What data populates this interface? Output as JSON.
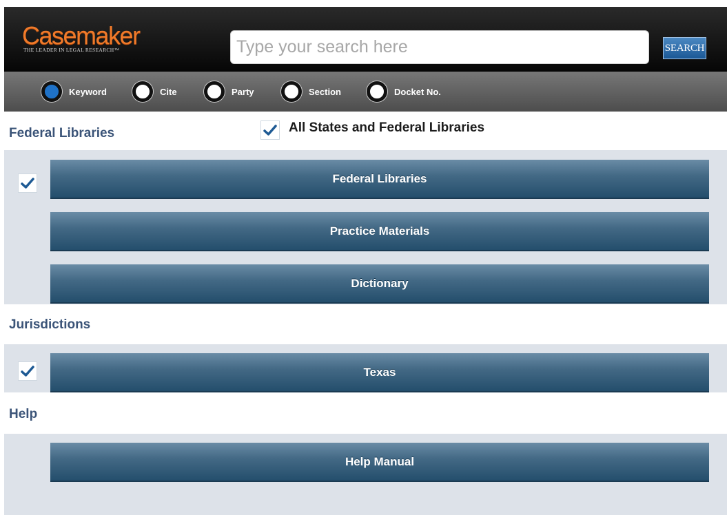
{
  "header": {
    "logo_text": "Casemaker",
    "logo_tagline": "THE LEADER IN LEGAL RESEARCH™",
    "search_placeholder": "Type your search here",
    "search_button": "SEARCH"
  },
  "search_types": [
    {
      "label": "Keyword",
      "selected": true
    },
    {
      "label": "Cite",
      "selected": false
    },
    {
      "label": "Party",
      "selected": false
    },
    {
      "label": "Section",
      "selected": false
    },
    {
      "label": "Docket No.",
      "selected": false
    }
  ],
  "federal": {
    "heading": "Federal Libraries",
    "all_states_label": "All States and Federal Libraries",
    "all_states_checked": true,
    "federal_checked": true,
    "buttons": [
      "Federal Libraries",
      "Practice Materials",
      "Dictionary"
    ]
  },
  "jurisdictions": {
    "heading": "Jurisdictions",
    "texas_checked": true,
    "buttons": [
      "Texas"
    ]
  },
  "help": {
    "heading": "Help",
    "buttons": [
      "Help Manual"
    ]
  },
  "colors": {
    "logo_orange": "#f07a2a",
    "section_heading": "#3b5478",
    "library_button": "#436985",
    "panel_bg": "#dde2e9",
    "selected_radio": "#1f72c8"
  }
}
